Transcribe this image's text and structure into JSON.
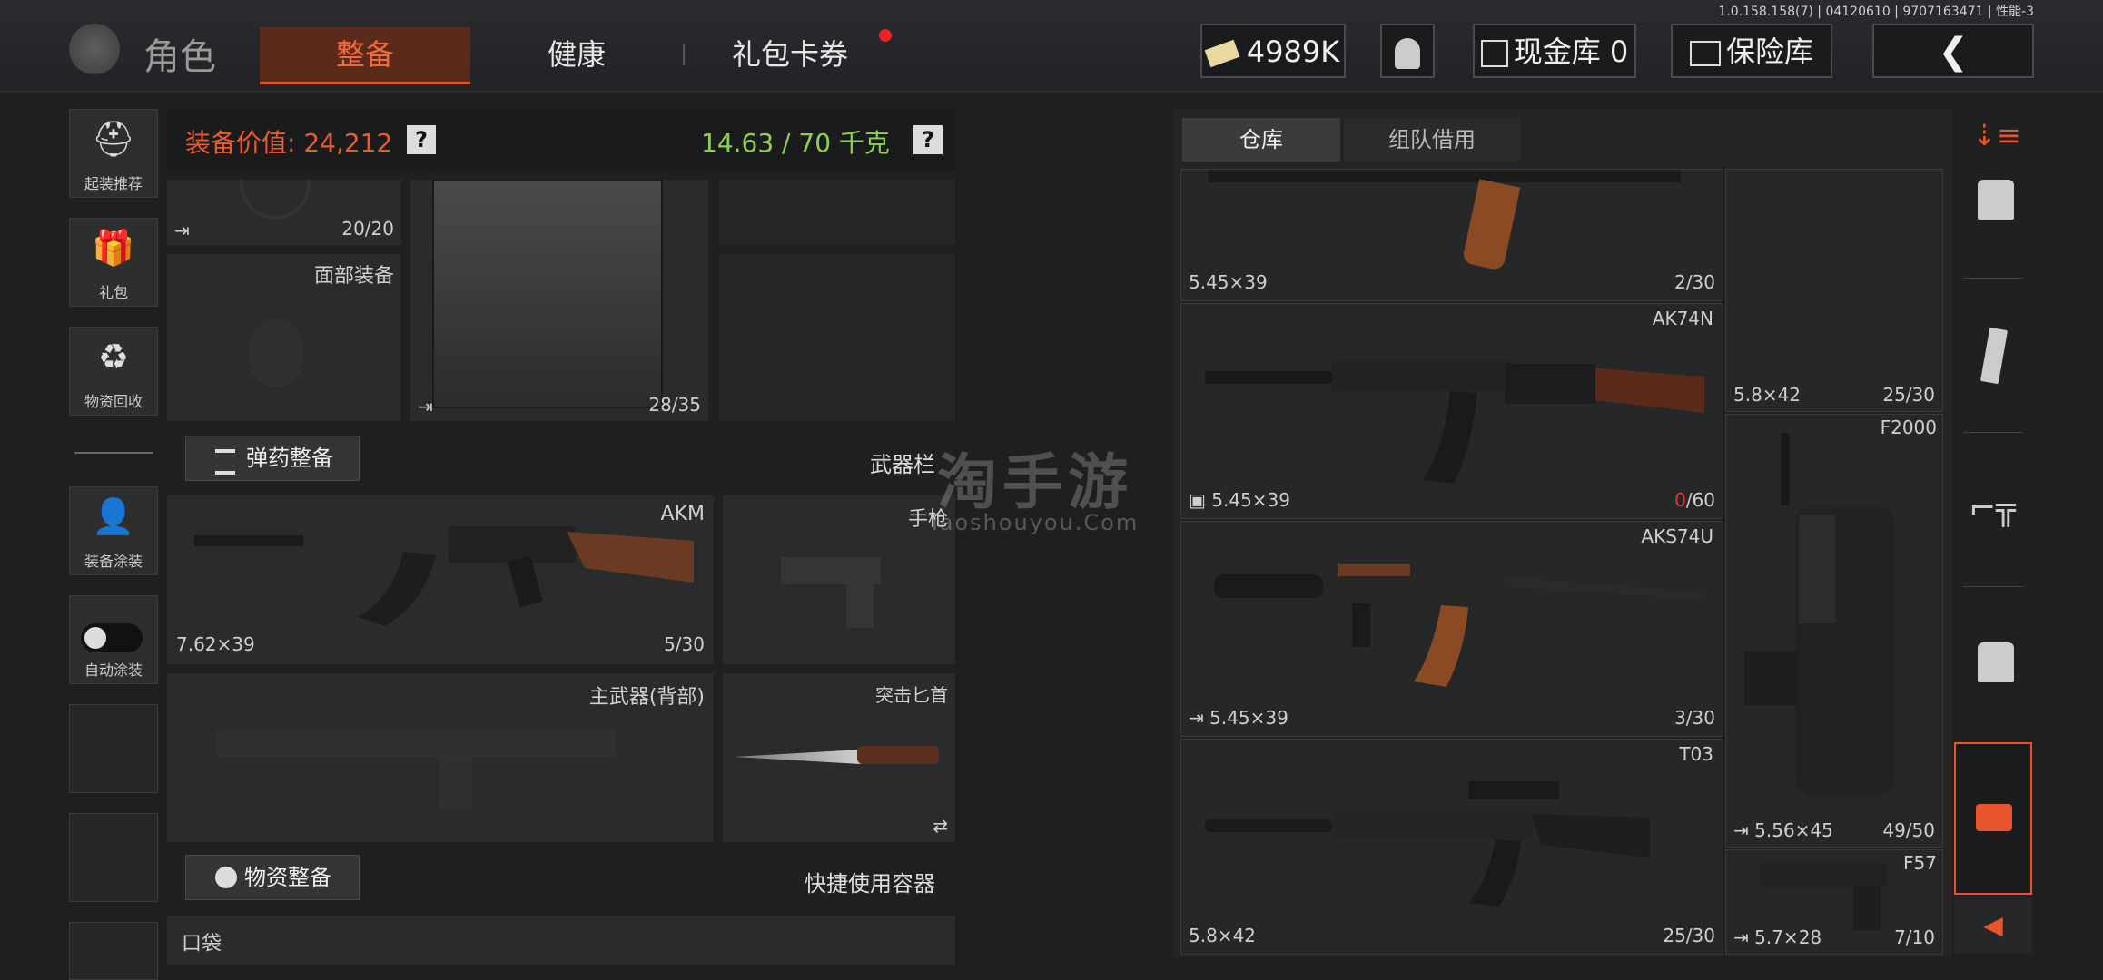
{
  "version": "1.0.158.158(7) | 04120610 | 9707163471 | 性能-3",
  "top": {
    "title": "角色",
    "tabs": [
      "整备",
      "健康",
      "礼包卡券"
    ],
    "money": "4989K",
    "cash_vault": "现金库 0",
    "safe": "保险库"
  },
  "sidebar": [
    "起装推荐",
    "礼包",
    "物资回收",
    "装备涂装",
    "自动涂装"
  ],
  "loadout": {
    "value_label": "装备价值: 24,212",
    "weight_label": "14.63 / 70 千克",
    "slot1_count": "20/20",
    "face_label": "面部装备",
    "armor_count": "28/35",
    "ammo_btn": "弹药整备",
    "weapon_bar": "武器栏",
    "akm_name": "AKM",
    "akm_ammo": "7.62×39",
    "akm_count": "5/30",
    "pistol": "手枪",
    "primary_back": "主武器(背部)",
    "knife": "突击匕首",
    "supply_btn": "物资整备",
    "quick_container": "快捷使用容器",
    "pocket": "口袋"
  },
  "warehouse": {
    "tabs": [
      "仓库",
      "组队借用"
    ],
    "items": [
      {
        "name": "",
        "ammo": "5.45×39",
        "count": "2/30"
      },
      {
        "name": "AK74N",
        "ammo": "5.45×39",
        "count_red": "0",
        "count": "/60"
      },
      {
        "name": "AKS74U",
        "ammo": "5.45×39",
        "count": "3/30"
      },
      {
        "name": "T03",
        "ammo": "5.8×42",
        "count": "25/30"
      },
      {
        "name": "",
        "ammo": "5.8×42",
        "count": "25/30"
      },
      {
        "name": "F2000",
        "ammo": "5.56×45",
        "count": "49/50"
      },
      {
        "name": "F57",
        "ammo": "5.7×28",
        "count": "7/10"
      }
    ]
  },
  "watermark": {
    "cn": "淘手游",
    "en": "Taoshouyou.Com"
  },
  "colors": {
    "accent": "#e8552a",
    "green": "#8fd14f",
    "red": "#e33"
  }
}
